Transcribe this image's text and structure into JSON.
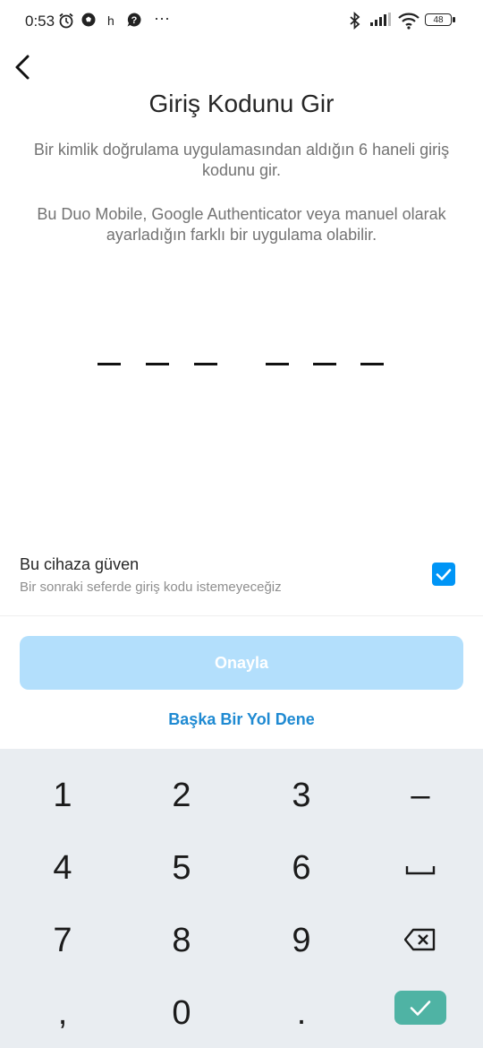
{
  "status_bar": {
    "time": "0:53",
    "h_label": "h",
    "more": "···",
    "battery": "48"
  },
  "header": {
    "back_icon": "chevron-left-icon",
    "title": "Giriş Kodunu Gir"
  },
  "description": {
    "line1": "Bir kimlik doğrulama uygulamasından aldığın 6 haneli giriş kodunu gir.",
    "line2": "Bu Duo Mobile, Google Authenticator veya manuel olarak ayarladığın farklı bir uygulama olabilir."
  },
  "code_input": {
    "digits": 6,
    "value": ""
  },
  "trust_device": {
    "title": "Bu cihaza güven",
    "subtitle": "Bir sonraki seferde giriş kodu istemeyeceğiz",
    "checked": true
  },
  "actions": {
    "confirm_label": "Onayla",
    "confirm_enabled": false,
    "alt_label": "Başka Bir Yol Dene"
  },
  "keyboard": {
    "keys": [
      "1",
      "2",
      "3",
      "–",
      "4",
      "5",
      "6",
      "␣",
      "7",
      "8",
      "9",
      "⌫",
      ",",
      "0",
      ".",
      "✓"
    ]
  },
  "colors": {
    "accent": "#0095f6",
    "button_disabled": "#b3dffc",
    "link": "#1f8ad2",
    "keyboard_bg": "#e9edf1",
    "ok_key": "#4fb3a4"
  }
}
